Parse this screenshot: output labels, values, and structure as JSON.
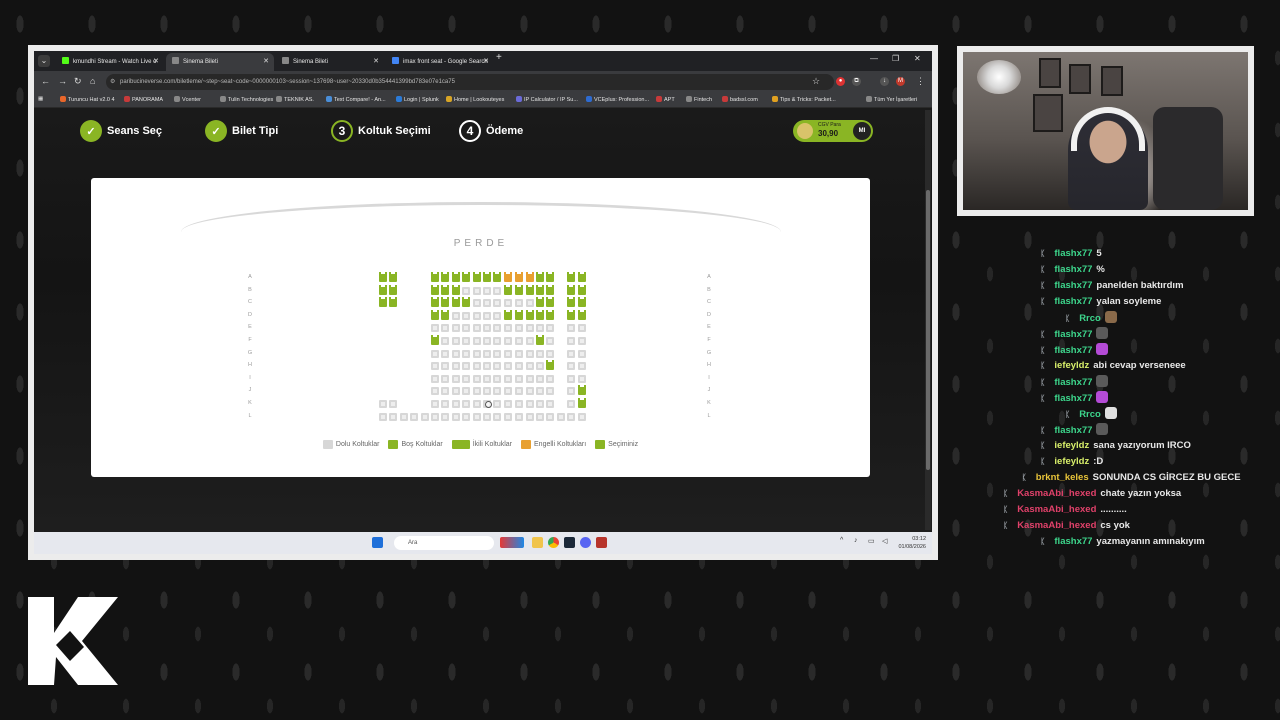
{
  "browser": {
    "tabs": [
      {
        "label": "kmundhi Stream - Watch Live o",
        "fav": "#53fc18",
        "active": false
      },
      {
        "label": "Sinema Bileti",
        "fav": "#888888",
        "active": true
      },
      {
        "label": "Sinema Bileti",
        "fav": "#888888",
        "active": false
      },
      {
        "label": "imax front seat - Google Search",
        "fav": "#4285f4",
        "active": false
      }
    ],
    "new_tab": "+",
    "url": "paribucineverse.com/biletleme/~step~seat~code~0000000103~session~137698~user~20330d0b354441399bd783e07e1ca75",
    "bookmarks": [
      "Turuncu Hat v2.0 4",
      "PANORAMA",
      "Vcenter",
      "Tulin Technologies",
      "TEKNIK AS.",
      "Text Compare! - An...",
      "Login | Splunk",
      "Home | Lookouteyes",
      "IP Calculator / IP Su...",
      "VCEplus: Profession...",
      "APT",
      "Fintech",
      "badssl.com",
      "Tips & Tricks: Packet...",
      "Tüm Yer İşaretleri"
    ]
  },
  "steps": [
    {
      "label": "Seans Seç",
      "state": "done",
      "mark": "✓"
    },
    {
      "label": "Bilet Tipi",
      "state": "done",
      "mark": "✓"
    },
    {
      "label": "Koltuk Seçimi",
      "state": "current",
      "mark": "3"
    },
    {
      "label": "Ödeme",
      "state": "todo",
      "mark": "4"
    }
  ],
  "wallet": {
    "label": "CGV Para",
    "amount": "30,90",
    "initials": "MI"
  },
  "screen_label": "PERDE",
  "rows": [
    "A",
    "B",
    "C",
    "D",
    "E",
    "F",
    "G",
    "H",
    "I",
    "J",
    "K",
    "L"
  ],
  "seat_map": [
    "EE___EEEEEEEDDDEE_EE",
    "EE___EEETTTTEEEEE_EE",
    "EE___EEEETTTTTTEE_EE",
    "_____EETTTTTEEEEE_EE",
    "_____TTTTTTTTTTTT_TT",
    "_____ETTTTTTTTTET_TT",
    "_____TTTTTTTTTTTT_TT",
    "_____TTTTTTTTTTTE_TT",
    "_____TTTTTTTTTTTT_TT",
    "_____TTTTTTTTTTTT_TE",
    "TT___TTTTTTTTTTTT_TE",
    "TTTTTTTTTTTTTTTTTTTT"
  ],
  "legend": [
    {
      "label": "Dolu Koltuklar",
      "color": "#d7d7d7",
      "kind": "single"
    },
    {
      "label": "Boş Koltuklar",
      "color": "#8ab524",
      "kind": "single"
    },
    {
      "label": "İkili Koltuklar",
      "color": "#8ab524",
      "kind": "pair"
    },
    {
      "label": "Engelli Koltukları",
      "color": "#e8a030",
      "kind": "single"
    },
    {
      "label": "Seçiminiz",
      "color": "#8ab524",
      "kind": "single"
    }
  ],
  "taskbar": {
    "search_placeholder": "Ara",
    "time": "03:12",
    "date": "01/08/2026"
  },
  "chat": [
    {
      "user": "flashx77",
      "color": "#3dd68c",
      "text": "5"
    },
    {
      "user": "flashx77",
      "color": "#3dd68c",
      "text": "%"
    },
    {
      "user": "flashx77",
      "color": "#3dd68c",
      "text": "panelden baktırdım"
    },
    {
      "user": "flashx77",
      "color": "#3dd68c",
      "text": "yalan soyleme"
    },
    {
      "user": "Rrco",
      "color": "#3dd68c",
      "text": "",
      "emote": "#8a6a4a"
    },
    {
      "user": "flashx77",
      "color": "#3dd68c",
      "text": "",
      "emote": "#5a5a5a"
    },
    {
      "user": "flashx77",
      "color": "#3dd68c",
      "text": "",
      "emote": "#b44bd6"
    },
    {
      "user": "iefeyldz",
      "color": "#d8ef6a",
      "text": "abi cevap verseneee"
    },
    {
      "user": "flashx77",
      "color": "#3dd68c",
      "text": "",
      "emote": "#5a5a5a"
    },
    {
      "user": "flashx77",
      "color": "#3dd68c",
      "text": "",
      "emote": "#b44bd6"
    },
    {
      "user": "Rrco",
      "color": "#3dd68c",
      "text": "",
      "emote": "#e0e0e0"
    },
    {
      "user": "flashx77",
      "color": "#3dd68c",
      "text": "",
      "emote": "#5a5a5a"
    },
    {
      "user": "iefeyldz",
      "color": "#d8ef6a",
      "text": "sana yazıyorum IRCO"
    },
    {
      "user": "iefeyldz",
      "color": "#d8ef6a",
      "text": ":D"
    },
    {
      "user": "brknt_keles",
      "color": "#e8c43a",
      "text": "SONUNDA CS GİRCEZ BU GECE"
    },
    {
      "user": "KasmaAbi_hexed",
      "color": "#e0416a",
      "text": "chate yazın yoksa"
    },
    {
      "user": "KasmaAbi_hexed",
      "color": "#e0416a",
      "text": ".........."
    },
    {
      "user": "KasmaAbi_hexed",
      "color": "#e0416a",
      "text": "cs yok"
    },
    {
      "user": "flashx77",
      "color": "#3dd68c",
      "text": "yazmayanın amınakıyım"
    }
  ]
}
